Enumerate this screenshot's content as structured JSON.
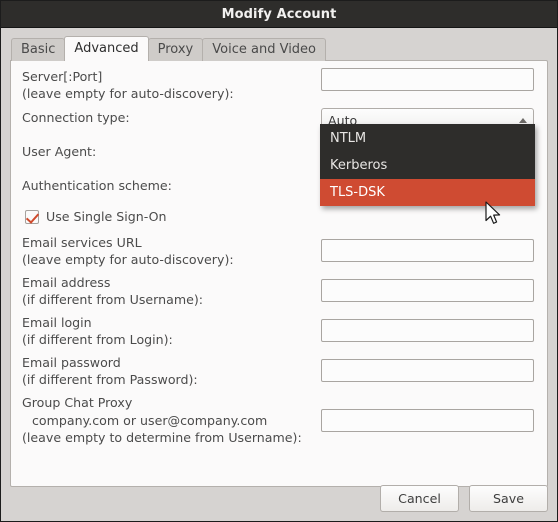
{
  "window": {
    "title": "Modify Account"
  },
  "tabs": [
    {
      "label": "Basic",
      "selected": false
    },
    {
      "label": "Advanced",
      "selected": true
    },
    {
      "label": "Proxy",
      "selected": false
    },
    {
      "label": "Voice and Video",
      "selected": false
    }
  ],
  "form": {
    "server": {
      "label": "Server[:Port]\n(leave empty for auto-discovery):",
      "value": "",
      "placeholder": ""
    },
    "connection_type": {
      "label": "Connection type:",
      "selected_value": "Auto",
      "options": [
        "Auto",
        "NTLM",
        "Kerberos",
        "TLS-DSK"
      ],
      "highlighted_option": "TLS-DSK",
      "visible_options": [
        "NTLM",
        "Kerberos",
        "TLS-DSK"
      ]
    },
    "user_agent": {
      "label": "User Agent:"
    },
    "auth_scheme": {
      "label": "Authentication scheme:"
    },
    "single_sign_on": {
      "label": "Use Single Sign-On",
      "checked": true
    },
    "email_services_url": {
      "label": "Email services URL\n(leave empty for auto-discovery):",
      "value": ""
    },
    "email_address": {
      "label": "Email address\n(if different from Username):",
      "value": ""
    },
    "email_login": {
      "label": "Email login\n(if different from Login):",
      "value": ""
    },
    "email_password": {
      "label": "Email password\n(if different from Password):",
      "value": ""
    },
    "group_chat_proxy": {
      "label_line1": "Group Chat Proxy",
      "label_line2": "company.com  or  user@company.com",
      "label_line3": "(leave empty to determine from Username):",
      "value": ""
    }
  },
  "footer": {
    "cancel_label": "Cancel",
    "save_label": "Save"
  },
  "colors": {
    "titlebar_bg": "#2e2d2b",
    "dialog_bg": "#d6d3d1",
    "panel_bg": "#fbfafa",
    "popup_bg": "#2e2d2b",
    "highlight": "#cf4b32",
    "checkmark": "#d04a2c"
  }
}
